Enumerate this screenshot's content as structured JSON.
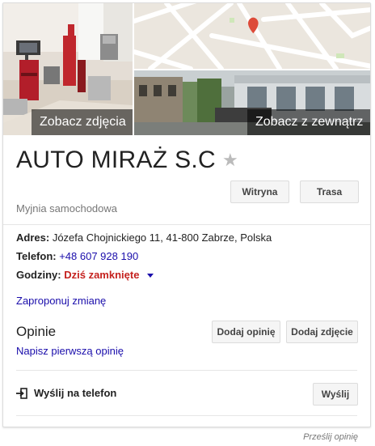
{
  "photos": {
    "main_caption": "Zobacz zdjęcia",
    "outside_caption": "Zobacz z zewnątrz"
  },
  "business": {
    "name": "AUTO MIRAŻ S.C",
    "category": "Myjnia samochodowa"
  },
  "actions": {
    "website_label": "Witryna",
    "directions_label": "Trasa"
  },
  "details": {
    "address_label": "Adres:",
    "address_value": "Józefa Chojnickiego 11, 41-800 Zabrze, Polska",
    "phone_label": "Telefon:",
    "phone_value": "+48 607 928 190",
    "hours_label": "Godziny:",
    "hours_value": "Dziś zamknięte",
    "suggest_edit": "Zaproponuj zmianę"
  },
  "reviews": {
    "title": "Opinie",
    "write_first": "Napisz pierwszą opinię",
    "add_review_label": "Dodaj opinię",
    "add_photo_label": "Dodaj zdjęcie"
  },
  "send": {
    "label": "Wyślij na telefon",
    "button_label": "Wyślij"
  },
  "footer": {
    "feedback": "Prześlij opinię"
  },
  "colors": {
    "link": "#1a0dab",
    "closed": "#c5221f",
    "map_pin": "#dd4b39"
  }
}
